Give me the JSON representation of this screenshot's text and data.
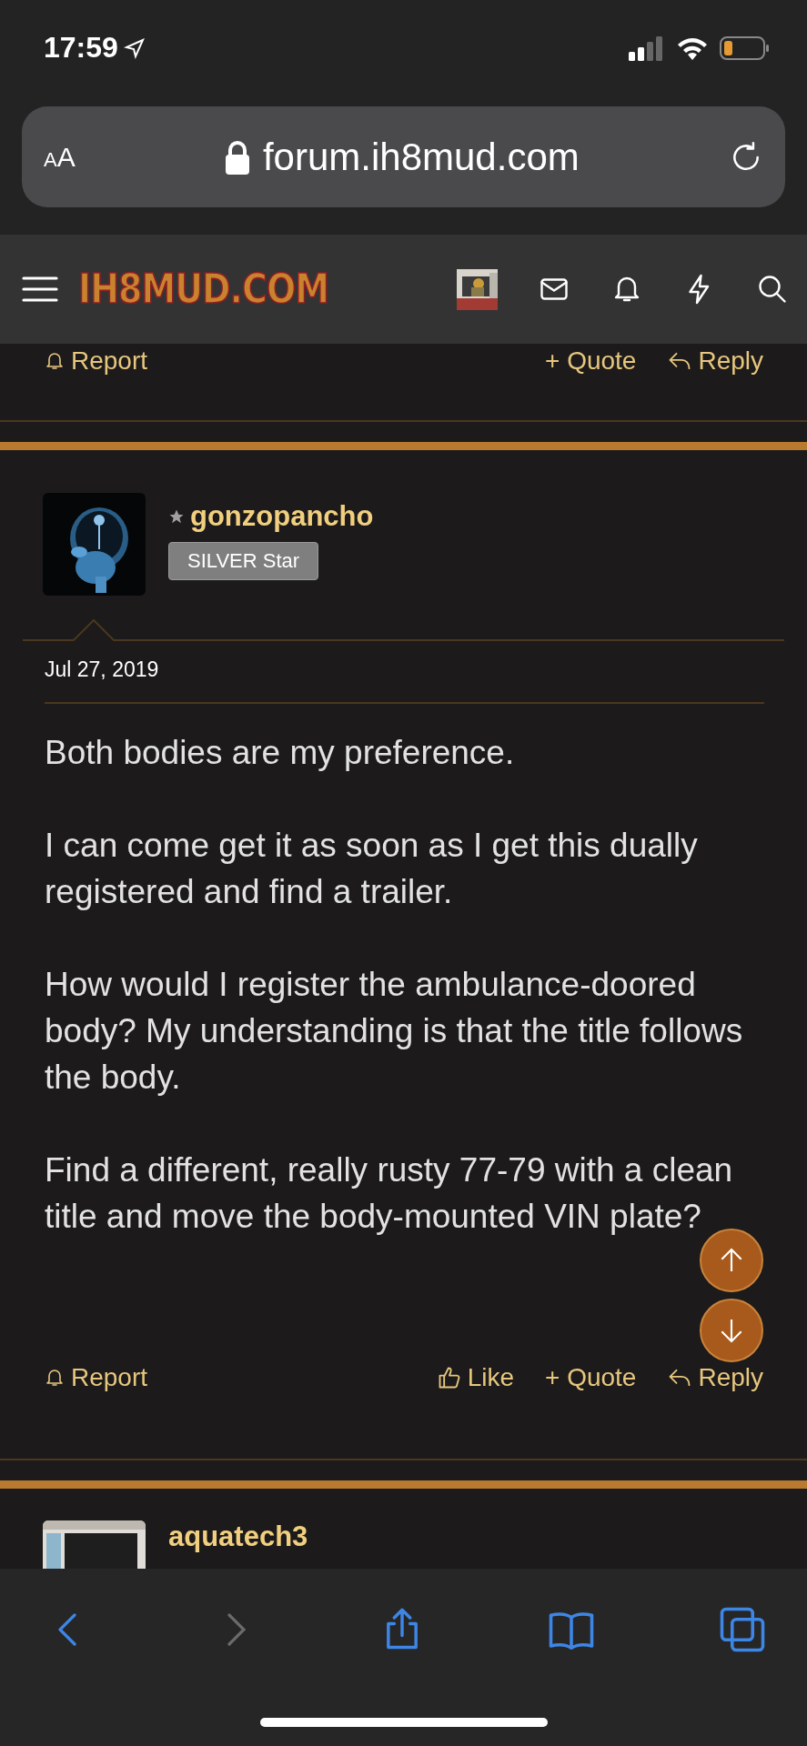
{
  "status_bar": {
    "time": "17:59"
  },
  "address_bar": {
    "text_size_button": "AA",
    "url": "forum.ih8mud.com"
  },
  "site_header": {
    "logo": "IH8MUD.COM"
  },
  "previous_post": {
    "actions": [
      {
        "kind": "report",
        "label": "Report"
      },
      {
        "kind": "quote",
        "label": "+ Quote"
      },
      {
        "kind": "reply",
        "label": "Reply"
      }
    ]
  },
  "post": {
    "author": "gonzopancho",
    "user_title": "SILVER Star",
    "date": "Jul 27, 2019",
    "paragraphs": [
      "Both bodies are my preference.",
      "I can come get it as soon as I get this dually registered and find a trailer.",
      "How would I register the ambulance-doored body? My understanding is that the title follows the body.",
      "Find a different, really rusty 77-79 with a clean title and move the body-mounted VIN plate?"
    ],
    "actions": [
      {
        "kind": "report",
        "label": "Report"
      },
      {
        "kind": "like",
        "label": "Like"
      },
      {
        "kind": "quote",
        "label": "+ Quote"
      },
      {
        "kind": "reply",
        "label": "Reply"
      }
    ]
  },
  "next_post": {
    "author": "aquatech3"
  }
}
